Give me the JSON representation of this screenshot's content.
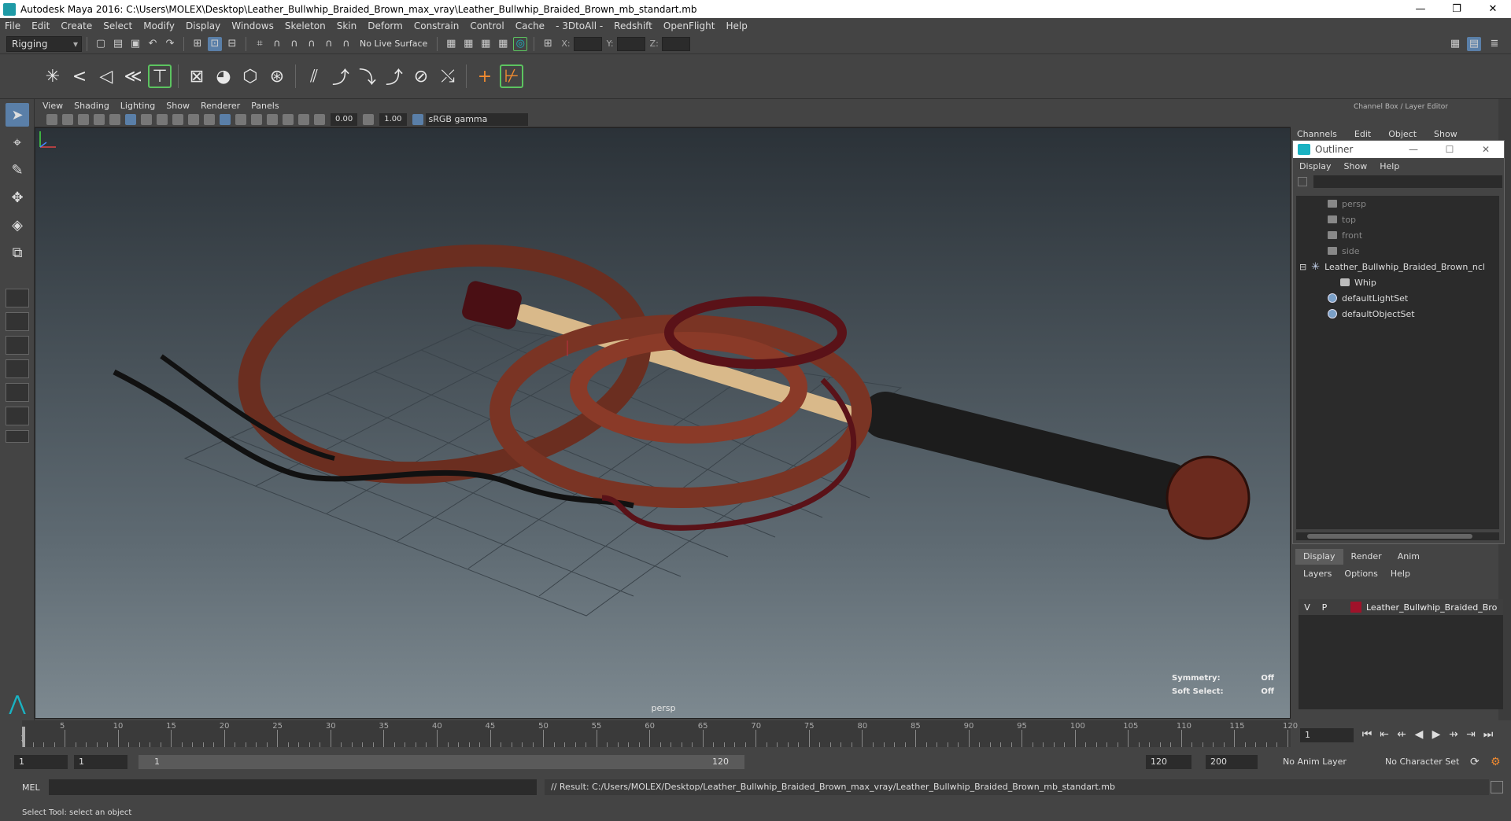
{
  "window": {
    "title": "Autodesk Maya 2016: C:\\Users\\MOLEX\\Desktop\\Leather_Bullwhip_Braided_Brown_max_vray\\Leather_Bullwhip_Braided_Brown_mb_standart.mb",
    "minimize": "—",
    "restore": "❐",
    "close": "✕"
  },
  "menubar": [
    "File",
    "Edit",
    "Create",
    "Select",
    "Modify",
    "Display",
    "Windows",
    "Skeleton",
    "Skin",
    "Deform",
    "Constrain",
    "Control",
    "Cache",
    "- 3DtoAll -",
    "Redshift",
    "OpenFlight",
    "Help"
  ],
  "statusline": {
    "mode": "Rigging",
    "live_surface": "No Live Surface",
    "x_label": "X:",
    "y_label": "Y:",
    "z_label": "Z:"
  },
  "panel": {
    "menu": [
      "View",
      "Shading",
      "Lighting",
      "Show",
      "Renderer",
      "Panels"
    ],
    "exposure": "0.00",
    "gamma_value": "1.00",
    "color_space": "sRGB gamma",
    "camera": "persp",
    "symmetry_label": "Symmetry:",
    "symmetry_value": "Off",
    "soft_select_label": "Soft Select:",
    "soft_select_value": "Off"
  },
  "channel_box": {
    "header": "Channel Box / Layer Editor",
    "menu": [
      "Channels",
      "Edit",
      "Object",
      "Show"
    ]
  },
  "outliner": {
    "title": "Outliner",
    "menu": [
      "Display",
      "Show",
      "Help"
    ],
    "items": [
      {
        "label": "persp",
        "icon": "camera-icon",
        "dim": true
      },
      {
        "label": "top",
        "icon": "camera-icon",
        "dim": true
      },
      {
        "label": "front",
        "icon": "camera-icon",
        "dim": true
      },
      {
        "label": "side",
        "icon": "camera-icon",
        "dim": true
      },
      {
        "label": "Leather_Bullwhip_Braided_Brown_ncl",
        "icon": "group-icon"
      },
      {
        "label": "Whip",
        "icon": "mesh-icon"
      },
      {
        "label": "defaultLightSet",
        "icon": "set-icon"
      },
      {
        "label": "defaultObjectSet",
        "icon": "set-icon"
      }
    ]
  },
  "layers": {
    "tabs": [
      "Display",
      "Render",
      "Anim"
    ],
    "menu": [
      "Layers",
      "Options",
      "Help"
    ],
    "row": {
      "v": "V",
      "p": "P",
      "name": "Leather_Bullwhip_Braided_Bro",
      "color": "#a0122a"
    }
  },
  "timeline": {
    "ticks": [
      "5",
      "10",
      "15",
      "20",
      "25",
      "30",
      "35",
      "40",
      "45",
      "50",
      "55",
      "60",
      "65",
      "70",
      "75",
      "80",
      "85",
      "90",
      "95",
      "100",
      "105",
      "110",
      "115",
      "120"
    ],
    "current_frame": "1",
    "start_cursor_label": "1"
  },
  "range": {
    "start": "1",
    "playback_start": "1",
    "range_start": "1",
    "range_end": "120",
    "playback_end": "120",
    "end": "200",
    "anim_layer": "No Anim Layer",
    "character_set": "No Character Set"
  },
  "command": {
    "label": "MEL",
    "result": "// Result: C:/Users/MOLEX/Desktop/Leather_Bullwhip_Braided_Brown_max_vray/Leather_Bullwhip_Braided_Brown_mb_standart.mb"
  },
  "help_line": "Select Tool: select an object"
}
